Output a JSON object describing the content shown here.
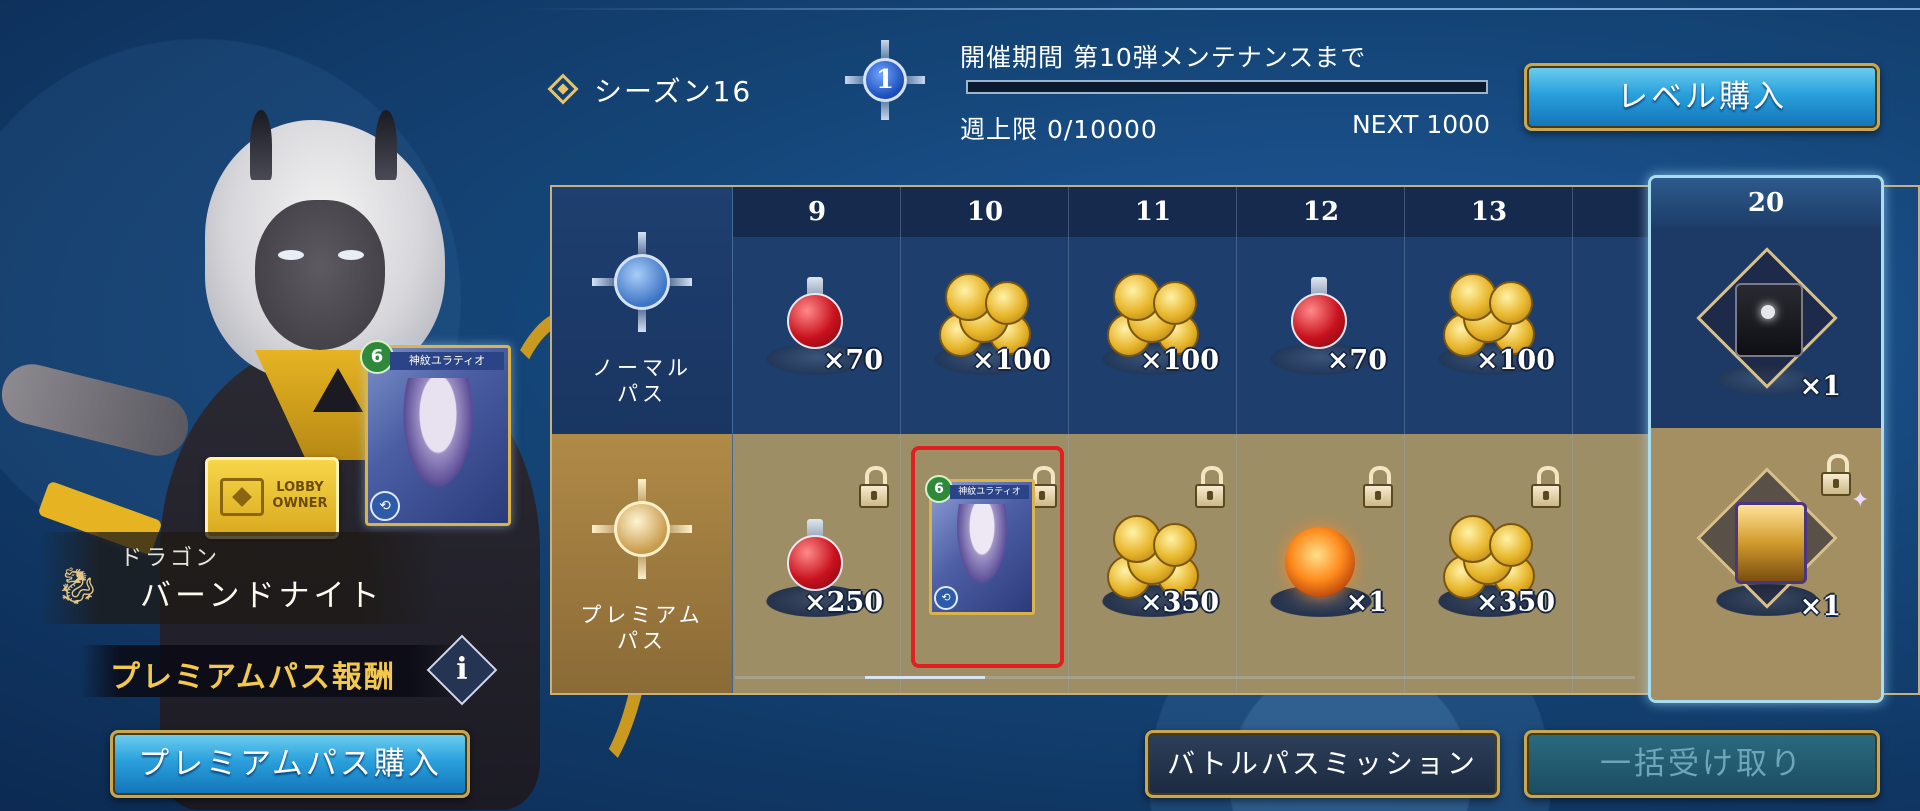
{
  "season": {
    "label": "シーズン16",
    "level": "1",
    "period_text": "開催期間 第10弾メンテナンスまで",
    "progress_fraction": 0.0,
    "week_limit": "週上限 0/10000",
    "next": "NEXT 1000"
  },
  "buttons": {
    "level_buy": "レベル購入",
    "premium_buy": "プレミアムパス購入",
    "mission": "バトルパスミッション",
    "claim_all": "一括受け取り"
  },
  "character": {
    "class_name": "ドラゴン",
    "title": "バーンドナイト",
    "reward_label": "プレミアムパス報酬",
    "info_icon": "i",
    "lobby_badge": "LOBBY\nOWNER",
    "held_card": {
      "cost": "6",
      "name": "神紋ユラティオ"
    }
  },
  "passes": {
    "normal": "ノーマル\nパス",
    "premium": "プレミアム\nパス"
  },
  "levels": [
    {
      "level": "9",
      "normal": {
        "item": "potion-icon",
        "qty": "×70"
      },
      "premium": {
        "item": "potion-icon",
        "qty": "×250",
        "locked": true
      }
    },
    {
      "level": "10",
      "normal": {
        "item": "coins-icon",
        "qty": "×100"
      },
      "premium": {
        "item": "card-icon",
        "qty": "",
        "locked": true,
        "card_cost": "6",
        "card_name": "神紋ユラティオ",
        "highlighted": true
      }
    },
    {
      "level": "11",
      "normal": {
        "item": "coins-icon",
        "qty": "×100"
      },
      "premium": {
        "item": "coins-icon",
        "qty": "×350",
        "locked": true
      }
    },
    {
      "level": "12",
      "normal": {
        "item": "potion-icon",
        "qty": "×70"
      },
      "premium": {
        "item": "orb-icon",
        "qty": "×1",
        "locked": true
      }
    },
    {
      "level": "13",
      "normal": {
        "item": "coins-icon",
        "qty": "×100"
      },
      "premium": {
        "item": "coins-icon",
        "qty": "×350",
        "locked": true
      }
    }
  ],
  "featured": {
    "level": "20",
    "normal": {
      "item": "card-box-icon",
      "qty": "×1"
    },
    "premium": {
      "item": "tome-icon",
      "qty": "×1",
      "locked": true
    }
  },
  "colors": {
    "accent_gold": "#c8a753",
    "button_blue": "#2aa0dc",
    "highlight_red": "#e02020"
  }
}
